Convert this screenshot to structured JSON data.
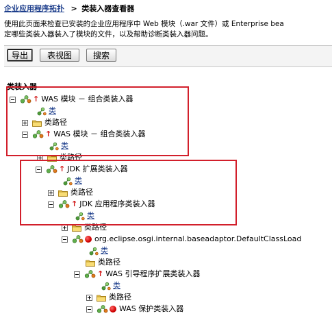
{
  "breadcrumb": {
    "parent": "企业应用程序拓扑",
    "separator": ">",
    "current": "类装入器查看器"
  },
  "description": {
    "line1": "使用此页面来检查已安装的企业应用程序中  Web 模块（.war 文件）或  Enterprise bea",
    "line2": "定哪些类装入器装入了模块的文件，以及帮助诊断类装入器问题。"
  },
  "toolbar": {
    "export_label": "导出",
    "table_view_label": "表视图",
    "search_label": "搜索"
  },
  "tree": {
    "section_label": "类装入器",
    "nodes": {
      "n1": "WAS 模块  －  组合类装入器",
      "n1_class": "类",
      "n1_classpath": "类路径",
      "n2": "WAS 模块  －  组合类装入器",
      "n2_class": "类",
      "n2_classpath": "类路径",
      "n3": "JDK 扩展类装入器",
      "n3_class": "类",
      "n3_classpath": "类路径",
      "n4": "JDK 应用程序类装入器",
      "n4_class": "类",
      "n4_classpath": "类路径",
      "n5": "org.eclipse.osgi.internal.baseadaptor.DefaultClassLoad",
      "n5_class": "类",
      "n5_classpath": "类路径",
      "n6": "WAS 引导程序扩展类装入器",
      "n6_class": "类",
      "n6_classpath": "类路径",
      "n7": "WAS 保护类装入器"
    }
  },
  "colors": {
    "link": "#1e3f8c",
    "highlight_box": "#d21f2b",
    "up_arrow": "#d01010"
  }
}
